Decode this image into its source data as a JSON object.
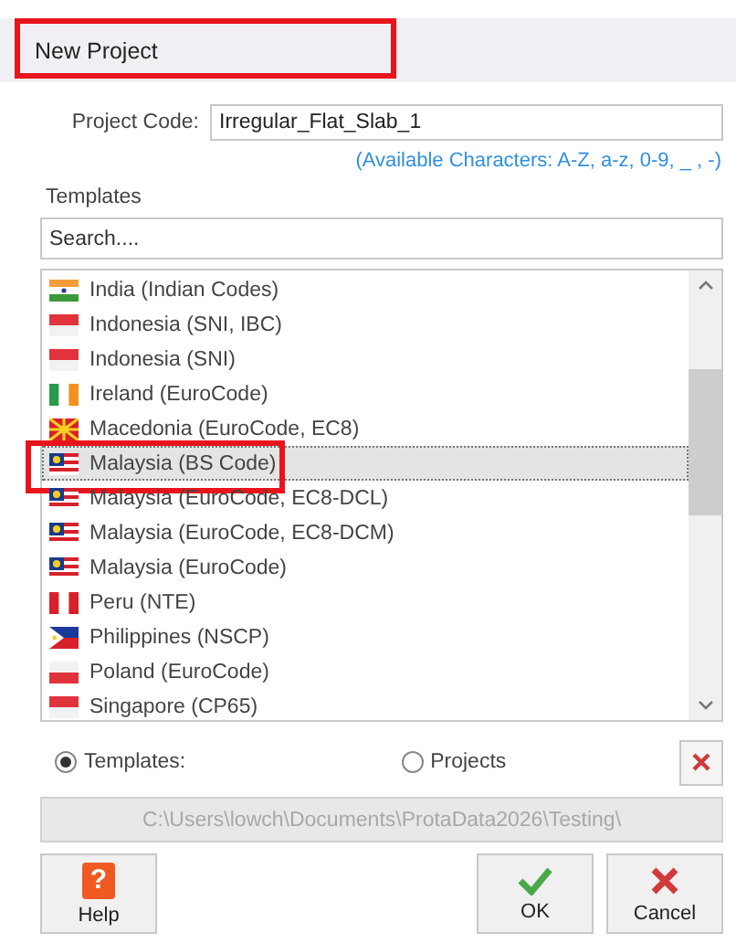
{
  "window": {
    "title": "New Project",
    "highlighted": true
  },
  "project_code": {
    "label": "Project Code:",
    "value": "Irregular_Flat_Slab_1",
    "hint": "(Available Characters: A-Z, a-z, 0-9, _ , -)"
  },
  "templates": {
    "label": "Templates",
    "search": {
      "placeholder": "Search...."
    },
    "items": [
      {
        "label": "India (Indian Codes)",
        "kind": "india",
        "selected": false,
        "highlighted": false
      },
      {
        "label": "Indonesia (SNI, IBC)",
        "kind": "redwhite",
        "selected": false,
        "highlighted": false
      },
      {
        "label": "Indonesia (SNI)",
        "kind": "redwhite",
        "selected": false,
        "highlighted": false
      },
      {
        "label": "Ireland (EuroCode)",
        "kind": "ireland",
        "selected": false,
        "highlighted": false
      },
      {
        "label": "Macedonia (EuroCode, EC8)",
        "kind": "macedonia",
        "selected": false,
        "highlighted": false
      },
      {
        "label": "Malaysia (BS Code)",
        "kind": "malaysia",
        "selected": true,
        "highlighted": true
      },
      {
        "label": "Malaysia (EuroCode, EC8-DCL)",
        "kind": "malaysia",
        "selected": false,
        "highlighted": false
      },
      {
        "label": "Malaysia (EuroCode, EC8-DCM)",
        "kind": "malaysia",
        "selected": false,
        "highlighted": false
      },
      {
        "label": "Malaysia (EuroCode)",
        "kind": "malaysia",
        "selected": false,
        "highlighted": false
      },
      {
        "label": "Peru (NTE)",
        "kind": "peru",
        "selected": false,
        "highlighted": false
      },
      {
        "label": "Philippines (NSCP)",
        "kind": "philippines",
        "selected": false,
        "highlighted": false
      },
      {
        "label": "Poland (EuroCode)",
        "kind": "whitered",
        "selected": false,
        "highlighted": false
      },
      {
        "label": "Singapore (CP65)",
        "kind": "redwhite",
        "selected": false,
        "highlighted": false
      }
    ]
  },
  "source": [
    {
      "label": "Templates:",
      "selected": true
    },
    {
      "label": "Projects",
      "selected": false
    }
  ],
  "path": {
    "value": "C:\\Users\\lowch\\Documents\\ProtaData2026\\Testing\\",
    "disabled": true
  },
  "buttons": [
    {
      "label": "Help",
      "kind": "help",
      "icon": "?"
    },
    {
      "label": "OK",
      "kind": "ok"
    },
    {
      "label": "Cancel",
      "kind": "cancel"
    }
  ]
}
